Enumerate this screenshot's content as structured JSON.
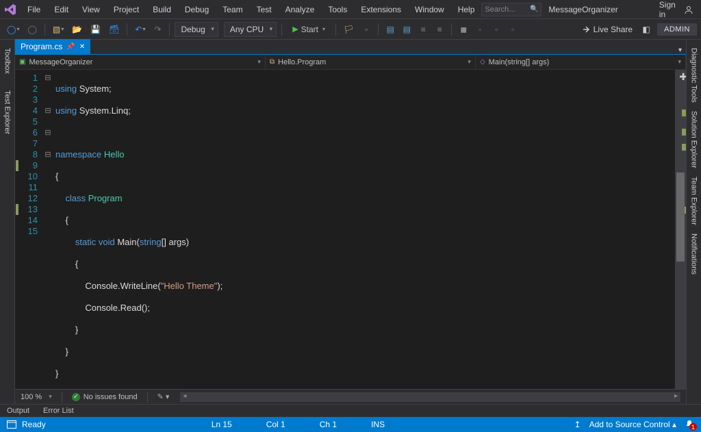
{
  "menu": {
    "items": [
      "File",
      "Edit",
      "View",
      "Project",
      "Build",
      "Debug",
      "Team",
      "Test",
      "Analyze",
      "Tools",
      "Extensions",
      "Window",
      "Help"
    ]
  },
  "titlebar": {
    "search_placeholder": "Search...",
    "solution_name": "MessageOrganizer",
    "signin": "Sign in"
  },
  "toolbar": {
    "config": "Debug",
    "platform": "Any CPU",
    "start": "Start",
    "liveshare": "Live Share",
    "admin": "ADMIN"
  },
  "left_rail": {
    "tabs": [
      "Toolbox",
      "Test Explorer"
    ]
  },
  "right_rail": {
    "tabs": [
      "Diagnostic Tools",
      "Solution Explorer",
      "Team Explorer",
      "Notifications"
    ]
  },
  "doc_tab": {
    "name": "Program.cs"
  },
  "nav": {
    "project": "MessageOrganizer",
    "class": "Hello.Program",
    "member": "Main(string[] args)"
  },
  "code": {
    "lines": [
      "1",
      "2",
      "3",
      "4",
      "5",
      "6",
      "7",
      "8",
      "9",
      "10",
      "11",
      "12",
      "13",
      "14",
      "15"
    ],
    "l1_kw": "using",
    "l1_rest": " System;",
    "l2_kw": "using",
    "l2_rest": " System.Linq;",
    "l4_kw": "namespace",
    "l4_name": " Hello",
    "l5": "{",
    "l6_kw": "class",
    "l6_name": " Program",
    "l7": "    {",
    "l8_kw1": "static ",
    "l8_kw2": "void ",
    "l8_name": "Main(",
    "l8_kw3": "string",
    "l8_rest": "[] args)",
    "l9": "        {",
    "l10_a": "            Console.WriteLine(",
    "l10_str": "\"Hello Theme\"",
    "l10_b": ");",
    "l11": "            Console.Read();",
    "l12": "        }",
    "l13": "    }",
    "l14": "}"
  },
  "editor_footer": {
    "zoom": "100 %",
    "issues": "No issues found"
  },
  "panels": {
    "tabs": [
      "Output",
      "Error List"
    ]
  },
  "status": {
    "ready": "Ready",
    "line": "Ln 15",
    "col": "Col 1",
    "ch": "Ch 1",
    "ins": "INS",
    "scc": "Add to Source Control",
    "notif_count": "1"
  }
}
